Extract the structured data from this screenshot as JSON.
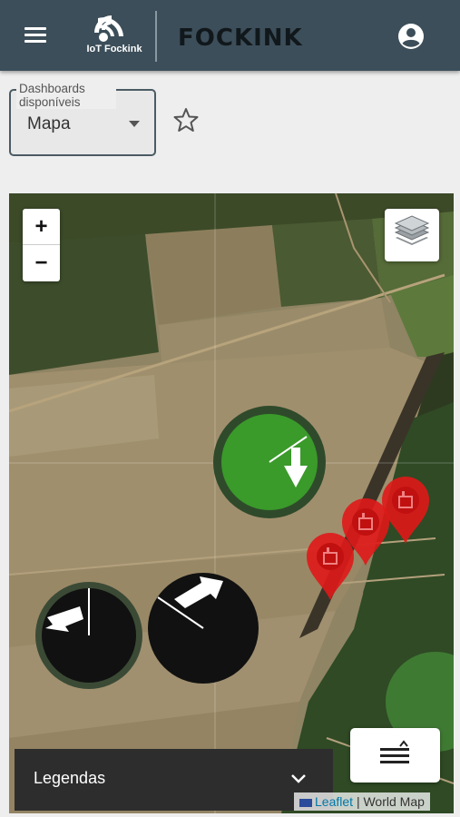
{
  "header": {
    "menu_icon": "menu-icon",
    "iot_logo_text": "IoT Fockink",
    "brand": "FOCKINK",
    "account_icon": "account-circle-icon",
    "background": "#3c4e59"
  },
  "dashboard_select": {
    "label": "Dashboards disponíveis",
    "value": "Mapa",
    "arrow_icon": "dropdown-arrow-icon"
  },
  "favorite_icon": "star-outline-icon",
  "map": {
    "zoom_in": "+",
    "zoom_out": "−",
    "layers_icon": "layers-icon",
    "legend_label": "Legendas",
    "legend_chevron_icon": "chevron-down-icon",
    "filter_icon": "sort-filter-icon",
    "attribution_link": "Leaflet",
    "attribution_separator": "|",
    "attribution_source": "World Map",
    "pivot_colors": {
      "active": "#3a9a2a",
      "inactive": "#111111"
    },
    "alert_color": "#e01818",
    "pivots": [
      {
        "name": "pivot-green",
        "status": "active"
      },
      {
        "name": "pivot-dark-left",
        "status": "inactive"
      },
      {
        "name": "pivot-dark-right",
        "status": "inactive"
      }
    ],
    "alerts": [
      {
        "icon": "alert-marker-icon"
      },
      {
        "icon": "alert-marker-icon"
      },
      {
        "icon": "alert-marker-icon"
      }
    ]
  }
}
